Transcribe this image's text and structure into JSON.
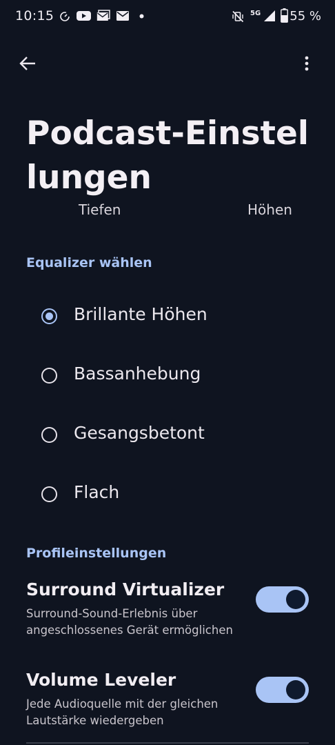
{
  "status_bar": {
    "time": "10:15",
    "network": "5G",
    "battery": "55 %"
  },
  "page": {
    "title": "Podcast-Einstellungen"
  },
  "equalizer_graph": {
    "bass_label": "Tiefen",
    "treble_label": "Höhen"
  },
  "equalizer_section": {
    "header": "Equalizer wählen",
    "options": [
      {
        "label": "Brillante Höhen",
        "selected": true
      },
      {
        "label": "Bassanhebung",
        "selected": false
      },
      {
        "label": "Gesangsbetont",
        "selected": false
      },
      {
        "label": "Flach",
        "selected": false
      }
    ]
  },
  "profile_section": {
    "header": "Profileinstellungen",
    "settings": [
      {
        "title": "Surround Virtualizer",
        "description": "Surround-Sound-Erlebnis über angeschlossenes Gerät ermöglichen",
        "enabled": true
      },
      {
        "title": "Volume Leveler",
        "description": "Jede Audioquelle mit der gleichen Lautstärke wiedergeben",
        "enabled": true
      }
    ]
  },
  "colors": {
    "background": "#0f1420",
    "accent": "#a9c4f5",
    "text_primary": "#f1edf2",
    "text_secondary": "#c9c5cc"
  },
  "icons": {
    "back": "arrow-left-icon",
    "more": "more-vertical-icon"
  }
}
